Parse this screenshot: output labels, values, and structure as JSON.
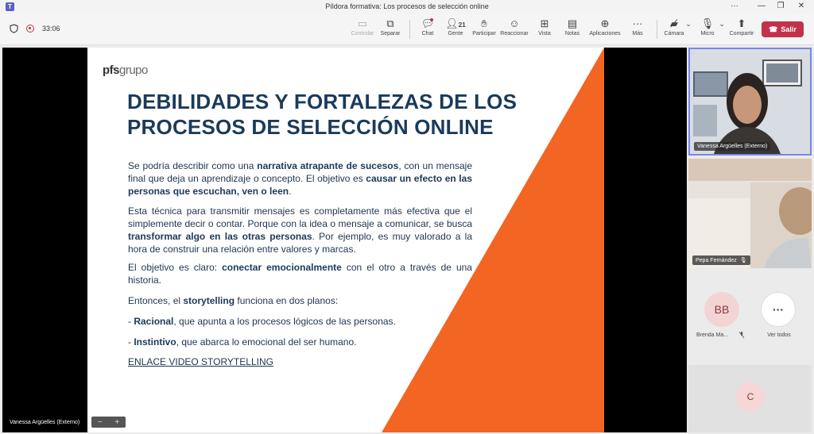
{
  "window": {
    "title": "Píldora formativa: Los procesos de selección online",
    "ctrl_more": "···",
    "ctrl_min": "—",
    "ctrl_restore": "❐",
    "ctrl_close": "✕"
  },
  "toolbar": {
    "timer": "33:06",
    "buttons": {
      "control": "Controlar",
      "separar": "Separar",
      "chat": "Chat",
      "gente": "Gente",
      "gente_count": "21",
      "participar": "Participar",
      "reaccionar": "Reaccionar",
      "vista": "Vista",
      "notas": "Notas",
      "aplicaciones": "Aplicaciones",
      "mas": "Más",
      "camara": "Cámara",
      "micro": "Micro",
      "compartir": "Compartir",
      "salir": "Salir"
    },
    "colors": {
      "leave": "#c4314b",
      "accent": "#5b5fc7"
    }
  },
  "slide": {
    "logo_main": "pfs",
    "logo_sub": "grupo",
    "title": "DEBILIDADES Y FORTALEZAS DE LOS PROCESOS DE SELECCIÓN ONLINE",
    "p1": [
      "Se podría describir como una ",
      "narrativa atrapante de sucesos",
      ", con un mensaje final que deja un aprendizaje o concepto. El objetivo es ",
      "causar un efecto en las personas que escuchan, ven o leen",
      "."
    ],
    "p2": [
      "Esta técnica para transmitir mensajes es completamente más efectiva que el simplemente decir o contar. Porque con la idea o mensaje a comunicar, se busca ",
      "transformar algo en las otras personas",
      ". Por ejemplo, es muy valorado a la hora de construir una relación entre valores y marcas."
    ],
    "p3": [
      "El objetivo es claro: ",
      "conectar emocionalmente",
      " con el otro a través de una historia."
    ],
    "p4": [
      "Entonces, el ",
      "storytelling",
      " funciona en dos planos:"
    ],
    "p5": [
      "- ",
      "Racional",
      ", que apunta a los procesos lógicos de las personas."
    ],
    "p6": [
      "- ",
      "Instintivo",
      ", que abarca lo emocional del ser humano."
    ],
    "link": "ENLACE VIDEO STORYTELLING",
    "colors": {
      "title": "#1b3a5a",
      "orange": "#f26522"
    }
  },
  "presenter_label": "Vanessa Argüelles (Externo)",
  "zoom": {
    "minus": "−",
    "plus": "+"
  },
  "participants": {
    "tile1": "Vanessa Argüelles (Externo)",
    "tile2": "Pepa Fernández",
    "bb_initials": "BB",
    "bb_name": "Brenda Ma...",
    "ver_todos": "Ver todos",
    "more_icon": "···",
    "c_initial": "C"
  }
}
